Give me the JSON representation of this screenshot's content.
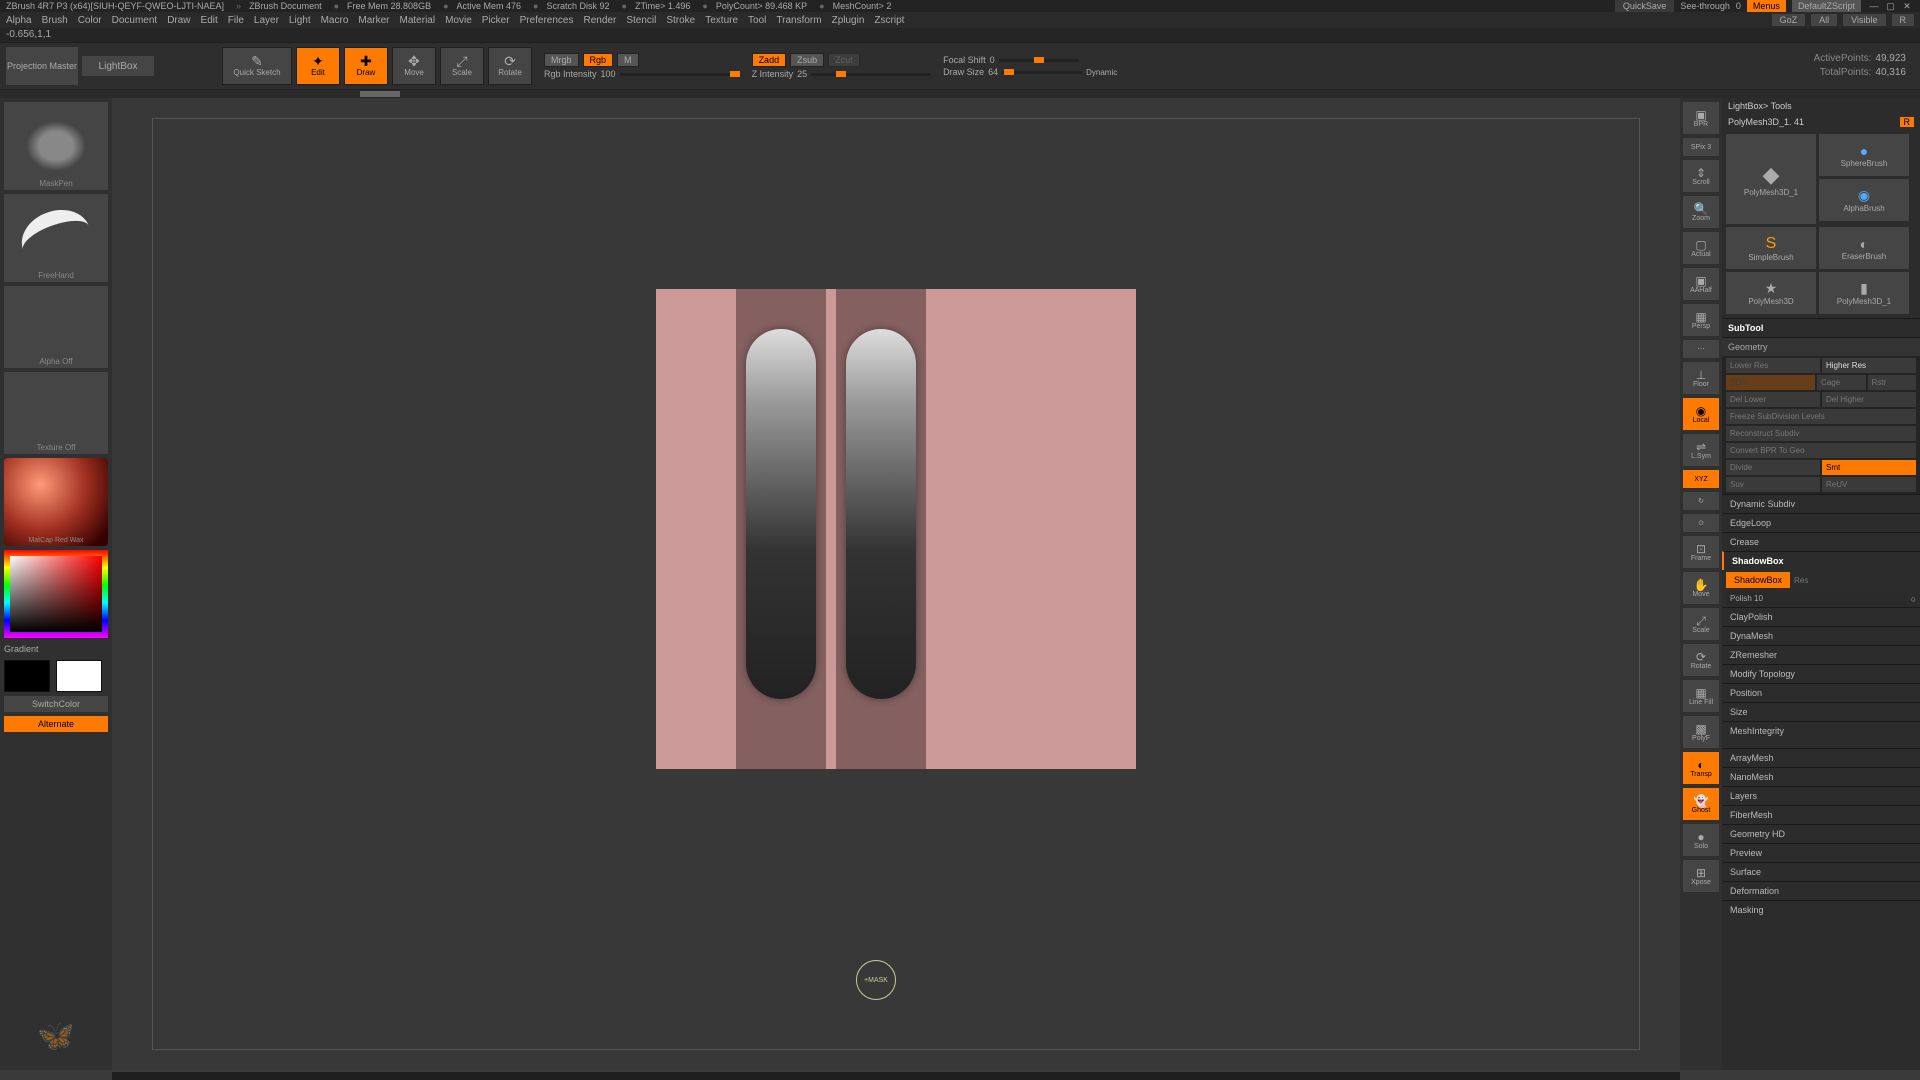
{
  "titlebar": {
    "app": "ZBrush 4R7 P3 (x64)[SIUH-QEYF-QWEO-LJTI-NAEA]",
    "doc": "ZBrush Document",
    "freemem": "Free Mem 28.808GB",
    "activemem": "Active Mem 476",
    "scratch": "Scratch Disk 92",
    "ztime": "ZTime> 1.496",
    "polycount": "PolyCount> 89.468 KP",
    "meshcount": "MeshCount> 2",
    "quicksave": "QuickSave",
    "seethrough": "See-through",
    "seethroughv": "0",
    "menus": "Menus",
    "defaultz": "DefaultZScript"
  },
  "menu": {
    "items": [
      "Alpha",
      "Brush",
      "Color",
      "Document",
      "Draw",
      "Edit",
      "File",
      "Layer",
      "Light",
      "Macro",
      "Marker",
      "Material",
      "Movie",
      "Picker",
      "Preferences",
      "Render",
      "Stencil",
      "Stroke",
      "Texture",
      "Tool",
      "Transform",
      "Zplugin",
      "Zscript"
    ],
    "right": {
      "goz": "GoZ",
      "all": "All",
      "visible": "Visible",
      "r": "R"
    }
  },
  "coord": "-0.656,1,1",
  "toolbar": {
    "proj": "Projection Master",
    "lightbox": "LightBox",
    "quicksketch": "Quick Sketch",
    "edit": "Edit",
    "draw": "Draw",
    "move": "Move",
    "scale": "Scale",
    "rotate": "Rotate",
    "mrgb": "Mrgb",
    "rgb": "Rgb",
    "m": "M",
    "rgbintensity_lbl": "Rgb Intensity",
    "rgbintensity_val": "100",
    "zadd": "Zadd",
    "zsub": "Zsub",
    "zcut": "Zcut",
    "zintensity_lbl": "Z Intensity",
    "zintensity_val": "25",
    "focalshift_lbl": "Focal Shift",
    "focalshift_val": "0",
    "drawsize_lbl": "Draw Size",
    "drawsize_val": "64",
    "dynamic": "Dynamic"
  },
  "stats": {
    "active_lbl": "ActivePoints:",
    "active_val": "49,923",
    "total_lbl": "TotalPoints:",
    "total_val": "40,316"
  },
  "left": {
    "brush": "MaskPen",
    "stroke": "FreeHand",
    "alpha": "Alpha Off",
    "texture": "Texture Off",
    "material": "MatCap Red Wax",
    "gradient": "Gradient",
    "switch": "SwitchColor",
    "alternate": "Alternate"
  },
  "cursor": "+MASK",
  "righttools": {
    "spix": "SPix 3",
    "items": [
      "BPR",
      "Scroll",
      "Zoom",
      "Actual",
      "AAHalf",
      "Persp",
      "Floor",
      "Local",
      "L.Sym",
      "XYZ",
      "",
      "",
      "Frame",
      "Move",
      "Scale",
      "Rotate",
      "Line Fill",
      "PolyF",
      "Transp",
      "Ghost",
      "Solo",
      "Xpose"
    ]
  },
  "rightpanel": {
    "lightbox": "LightBox> Tools",
    "current": "PolyMesh3D_1. 41",
    "r": "R",
    "tools": [
      {
        "name": "PolyMesh3D_1",
        "ic": "◆"
      },
      {
        "name": "SphereBrush",
        "ic": "●"
      },
      {
        "name": "AlphaBrush",
        "ic": "●"
      },
      {
        "name": "SimpleBrush",
        "ic": "S"
      },
      {
        "name": "EraserBrush",
        "ic": "◐"
      },
      {
        "name": "PolyMesh3D",
        "ic": "★"
      },
      {
        "name": "PolyMesh3D_1",
        "ic": "▮"
      }
    ],
    "subtool": "SubTool",
    "geometry": "Geometry",
    "geom": {
      "lower": "Lower Res",
      "higher": "Higher Res",
      "sdiv": "SDiv",
      "cage": "Cage",
      "rstr": "Rstr",
      "dellower": "Del Lower",
      "delhigher": "Del Higher",
      "freeze": "Freeze SubDivision Levels",
      "reconstruct": "Reconstruct Subdiv",
      "convert": "Convert BPR To Geo",
      "divide": "Divide",
      "smt": "Smt",
      "suv": "Suv",
      "resuv": "ReUV"
    },
    "sections": [
      "Dynamic Subdiv",
      "EdgeLoop",
      "Crease"
    ],
    "shadowbox": "ShadowBox",
    "shadowbox_btn": "ShadowBox",
    "res": "Res",
    "polish_lbl": "Polish",
    "polish_val": "10",
    "lower_sections": [
      "ClayPolish",
      "DynaMesh",
      "ZRemesher",
      "Modify Topology",
      "Position",
      "Size",
      "MeshIntegrity"
    ],
    "accordion": [
      "ArrayMesh",
      "NanoMesh",
      "Layers",
      "FiberMesh",
      "Geometry HD",
      "Preview",
      "Surface",
      "Deformation",
      "Masking"
    ]
  }
}
